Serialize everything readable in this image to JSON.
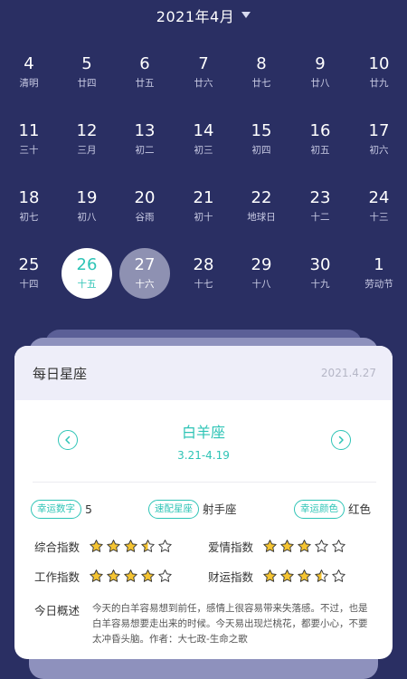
{
  "header": {
    "month": "2021年4月"
  },
  "calendar": {
    "weeks": [
      [
        {
          "day": "4",
          "sub": "清明"
        },
        {
          "day": "5",
          "sub": "廿四"
        },
        {
          "day": "6",
          "sub": "廿五"
        },
        {
          "day": "7",
          "sub": "廿六"
        },
        {
          "day": "8",
          "sub": "廿七"
        },
        {
          "day": "9",
          "sub": "廿八"
        },
        {
          "day": "10",
          "sub": "廿九"
        }
      ],
      [
        {
          "day": "11",
          "sub": "三十"
        },
        {
          "day": "12",
          "sub": "三月"
        },
        {
          "day": "13",
          "sub": "初二"
        },
        {
          "day": "14",
          "sub": "初三"
        },
        {
          "day": "15",
          "sub": "初四"
        },
        {
          "day": "16",
          "sub": "初五"
        },
        {
          "day": "17",
          "sub": "初六"
        }
      ],
      [
        {
          "day": "18",
          "sub": "初七"
        },
        {
          "day": "19",
          "sub": "初八"
        },
        {
          "day": "20",
          "sub": "谷雨"
        },
        {
          "day": "21",
          "sub": "初十"
        },
        {
          "day": "22",
          "sub": "地球日"
        },
        {
          "day": "23",
          "sub": "十二"
        },
        {
          "day": "24",
          "sub": "十三"
        }
      ],
      [
        {
          "day": "25",
          "sub": "十四"
        },
        {
          "day": "26",
          "sub": "十五",
          "state": "today"
        },
        {
          "day": "27",
          "sub": "十六",
          "state": "selected"
        },
        {
          "day": "28",
          "sub": "十七"
        },
        {
          "day": "29",
          "sub": "十八"
        },
        {
          "day": "30",
          "sub": "十九"
        },
        {
          "day": "1",
          "sub": "劳动节"
        }
      ]
    ]
  },
  "card": {
    "title": "每日星座",
    "date": "2021.4.27",
    "sign": {
      "name": "白羊座",
      "range": "3.21-4.19"
    },
    "info": {
      "lucky_number_label": "幸运数字",
      "lucky_number": "5",
      "match_label": "速配星座",
      "match": "射手座",
      "lucky_color_label": "幸运颜色",
      "lucky_color": "红色"
    },
    "ratings": [
      {
        "label": "综合指数",
        "stars": 3.5
      },
      {
        "label": "爱情指数",
        "stars": 3
      },
      {
        "label": "工作指数",
        "stars": 4
      },
      {
        "label": "财运指数",
        "stars": 3.5
      }
    ],
    "summary_label": "今日概述",
    "summary_text": "今天的白羊容易想到前任，感情上很容易带来失落感。不过，也是白羊容易想要走出来的时候。今天易出现烂桃花，都要小心，不要太冲昏头脑。作者：大七政-生命之歌"
  },
  "colors": {
    "background": "#2a2f63",
    "accent": "#2ec4b6",
    "star": "#f5c431"
  },
  "icons": {
    "prev": "chevron-left-icon",
    "next": "chevron-right-icon",
    "month_dropdown": "caret-down-icon",
    "rating": "star-icon"
  }
}
